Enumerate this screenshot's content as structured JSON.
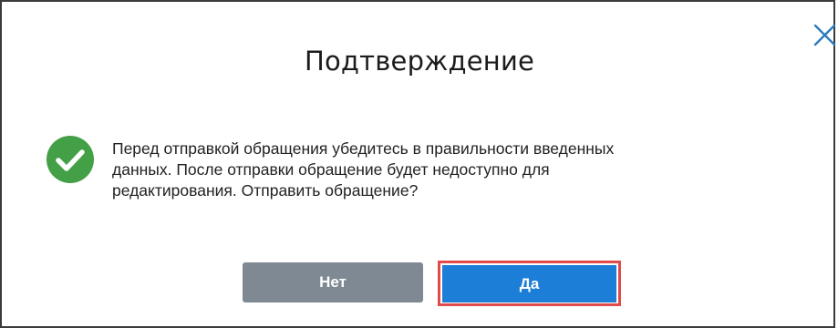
{
  "dialog": {
    "title": "Подтверждение",
    "message_lines": [
      "Перед отправкой обращения убедитесь в правильности введенных",
      "данных. После отправки обращение будет недоступно для",
      "редактирования. Отправить обращение?"
    ],
    "no_label": "Нет",
    "yes_label": "Да",
    "close_icon": "close-icon",
    "status_icon": "check-circle-icon"
  },
  "colors": {
    "check_green": "#43a047",
    "no_button": "#7e8993",
    "yes_button": "#1c7ed6",
    "highlight": "#e24b4b",
    "close_icon": "#2b7bbf"
  }
}
